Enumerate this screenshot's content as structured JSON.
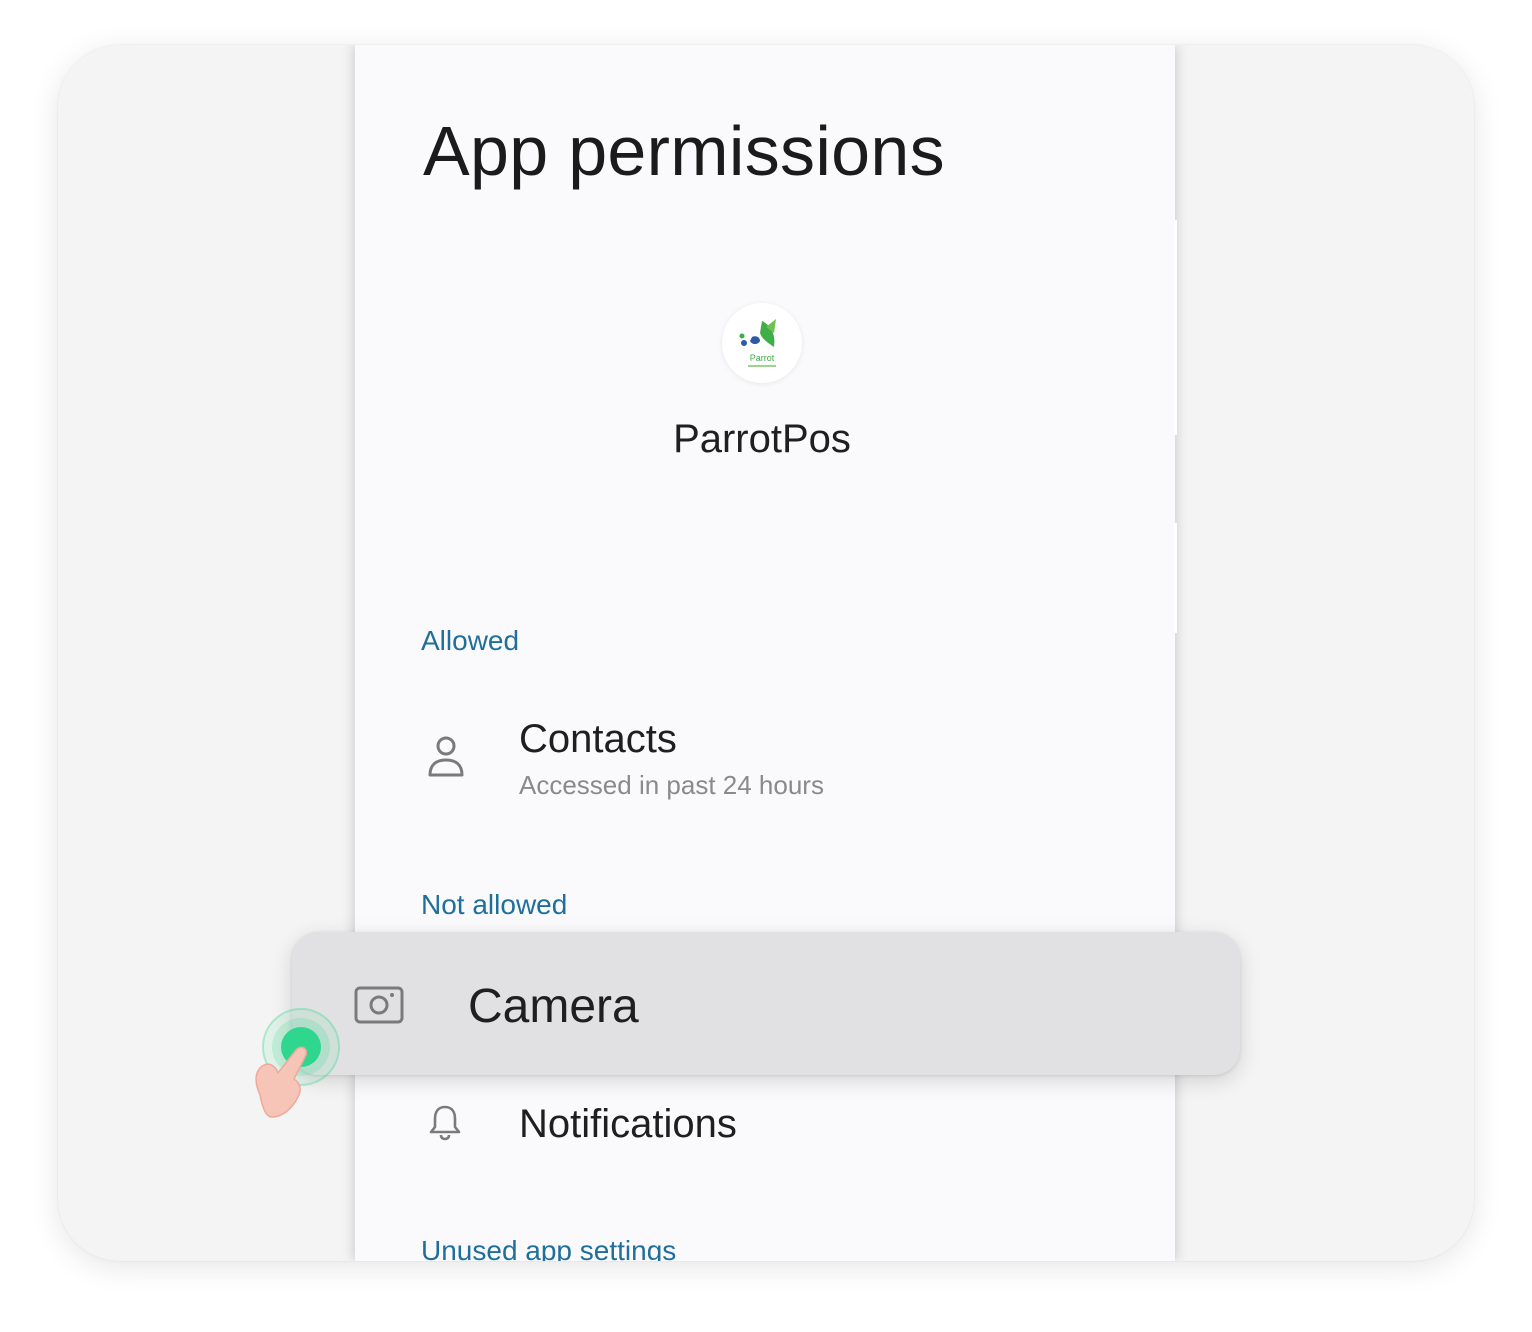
{
  "screen": {
    "title": "App permissions",
    "app": {
      "name": "ParrotPos",
      "icon": "parrotpos-logo-icon",
      "icon_wordmark": "Parrot"
    }
  },
  "sections": {
    "allowed": {
      "header": "Allowed",
      "items": [
        {
          "title": "Contacts",
          "subtitle": "Accessed in past 24 hours",
          "icon": "person-icon"
        }
      ]
    },
    "not_allowed": {
      "header": "Not allowed",
      "items": [
        {
          "title": "Camera",
          "icon": "camera-icon",
          "highlighted": true
        },
        {
          "title": "Notifications",
          "icon": "bell-icon"
        }
      ]
    },
    "unused": {
      "header": "Unused app settings"
    }
  },
  "overlay": {
    "tap_indicator": "hand-tap-icon"
  },
  "colors": {
    "section_header": "#1f6f9a",
    "highlight_card": "#e1e1e3",
    "tap_green": "#2fd68d",
    "hand": "#f7c4b8"
  }
}
